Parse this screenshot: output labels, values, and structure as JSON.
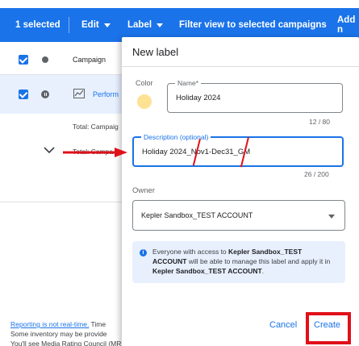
{
  "toolbar": {
    "selected": "1 selected",
    "edit": "Edit",
    "label": "Label",
    "filter": "Filter view to selected campaigns",
    "add": "Add n"
  },
  "table": {
    "header": "Campaign",
    "row_name": "Perform",
    "total1": "Total: Campaig",
    "total2": "Total: Campa"
  },
  "footer": {
    "line1_link": "Reporting is not real-time.",
    "line1_rest": " Time",
    "line2": "Some inventory may be provide",
    "line3": "You'll see Media Rating Council (MRC) accreditation noted in the column header"
  },
  "dialog": {
    "title": "New label",
    "color_label": "Color",
    "swatch_color": "#fde293",
    "name_label": "Name*",
    "name_value": "Holiday 2024",
    "name_counter": "12 / 80",
    "desc_label": "Description (optional)",
    "desc_value": "Holiday 2024_Nov1-Dec31_GM",
    "desc_counter": "26 / 200",
    "owner_label": "Owner",
    "owner_value": "Kepler Sandbox_TEST ACCOUNT",
    "info_icon": "info-icon",
    "info_pre": "Everyone with access to ",
    "info_account1": "Kepler Sandbox_TEST ACCOUNT",
    "info_mid": " will be able to manage this label and apply it in ",
    "info_account2": "Kepler Sandbox_TEST ACCOUNT",
    "info_end": ".",
    "cancel": "Cancel",
    "create": "Create"
  },
  "colors": {
    "accent": "#1a73e8",
    "annotation_red": "#e0101a"
  }
}
